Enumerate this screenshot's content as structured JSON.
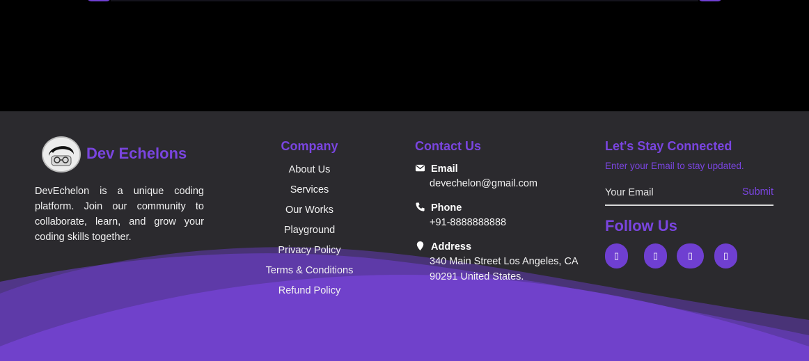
{
  "brand": {
    "name": "Dev Echelons",
    "description": "DevEchelon is a unique coding platform. Join our community to collaborate, learn, and grow your coding skills together."
  },
  "company": {
    "heading": "Company",
    "links": [
      "About Us",
      "Services",
      "Our Works",
      "Playground",
      "Privacy Policy",
      "Terms & Conditions",
      "Refund Policy"
    ]
  },
  "contact": {
    "heading": "Contact Us",
    "email_label": "Email",
    "email_value": "devechelon@gmail.com",
    "phone_label": "Phone",
    "phone_value": "+91-8888888888",
    "address_label": "Address",
    "address_value": "340 Main Street Los Angeles, CA 90291 United States."
  },
  "connect": {
    "heading": "Let's Stay Connected",
    "subtext": "Enter your Email to stay updated.",
    "email_placeholder": "Your Email",
    "submit_label": "Submit",
    "follow_heading": "Follow Us",
    "social_glyph": "▯"
  },
  "colors": {
    "accent": "#7a45e0",
    "footer_bg": "#2b2a2e",
    "wave": "#6f3fd1"
  },
  "icons": [
    "envelope-icon",
    "phone-icon",
    "location-pin-icon",
    "social-icon"
  ]
}
